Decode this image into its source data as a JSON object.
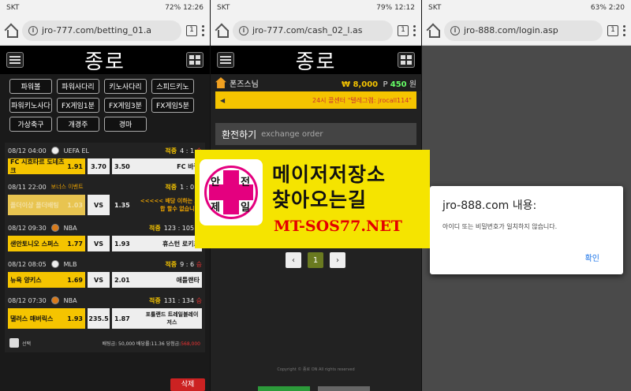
{
  "screen1": {
    "status": {
      "carrier": "SKT",
      "battery": "72%",
      "time": "12:26"
    },
    "url": "jro-777.com/betting_01.a",
    "tab_count": "1",
    "logo": "종로",
    "games": [
      "파워볼",
      "파워사다리",
      "키노사다리",
      "스피드키노",
      "파워키노사다",
      "FX게임1분",
      "FX게임3분",
      "FX게임5분",
      "가상축구",
      "개경주",
      "경마"
    ],
    "bets": [
      {
        "date": "08/12 04:00",
        "league": "UEFA EL",
        "result_label": "적중",
        "score": "4 : 1",
        "outcome": "승",
        "home": "FC 시흐타르 도네츠크",
        "home_odds": "1.91",
        "draw": "3.70",
        "away_odds": "3.50",
        "away": "FC 바젤"
      },
      {
        "date": "08/11 22:00",
        "league": "보너스 이벤트",
        "result_label": "적중",
        "score": "1 : 0",
        "outcome": "승",
        "home": "폴더이상 폴더배팅",
        "home_odds": "1.03",
        "draw": "VS",
        "away_odds": "1.35",
        "away": "<<<<< 배당 이하는 조합 할수 없습니다"
      },
      {
        "date": "08/12 09:30",
        "league": "NBA",
        "result_label": "적중",
        "score": "123 : 105",
        "outcome": "승",
        "home": "샌안토니오 스퍼스",
        "home_odds": "1.77",
        "draw": "VS",
        "away_odds": "1.93",
        "away": "휴스턴 로키츠"
      },
      {
        "date": "08/12 08:05",
        "league": "MLB",
        "result_label": "적중",
        "score": "9 : 6",
        "outcome": "승",
        "home": "뉴욕 양키스",
        "home_odds": "1.69",
        "draw": "VS",
        "away_odds": "2.01",
        "away": "애틀랜타"
      },
      {
        "date": "08/12 07:30",
        "league": "NBA",
        "result_label": "적중",
        "score": "131 : 134",
        "outcome": "승",
        "home": "댈러스 매버릭스",
        "home_odds": "1.93",
        "draw": "235.5",
        "away_odds": "1.87",
        "away": "포틀랜드 트레일블레이저스"
      }
    ],
    "footer": {
      "select_label": "선택",
      "summary": "배팅금: 50,000 배당률:11.36 당첨금:",
      "win_amount": "568,000",
      "delete_label": "삭제"
    }
  },
  "screen2": {
    "status": {
      "carrier": "SKT",
      "battery": "79%",
      "time": "12:12"
    },
    "url": "jro-777.com/cash_02_l.as",
    "tab_count": "1",
    "logo": "종로",
    "user": "폰즈스님",
    "money": "₩ 8,000",
    "points_prefix": "P",
    "points": "450",
    "points_unit": "원",
    "ticker": "24시 콜센터 \"텔레그램: jrocall114\"",
    "exchange_title": "환전하기",
    "exchange_sub": "exchange order",
    "page": "1",
    "prev": "‹",
    "next": "›",
    "copyright": "Copyright © 종로 ON All rights reserved"
  },
  "screen3": {
    "status": {
      "carrier": "SKT",
      "battery": "63%",
      "time": "2:20"
    },
    "url": "jro-888.com/login.asp",
    "tab_count": "1",
    "dialog_title": "jro-888.com 내용:",
    "dialog_message": "아이디 또는 비밀번호가 일치하지 않습니다.",
    "dialog_ok": "확인"
  },
  "ad": {
    "badge_chars": [
      "안",
      "전",
      "제",
      "일"
    ],
    "line1": "메이저저장소",
    "line2": "찾아오는길",
    "site": "MT-SOS77.NET"
  },
  "colors": {
    "accent": "#f5c400",
    "alert": "#e33333",
    "ad_bg": "#f5e400",
    "ad_cross": "#e4007f",
    "link": "#1a73e8"
  }
}
